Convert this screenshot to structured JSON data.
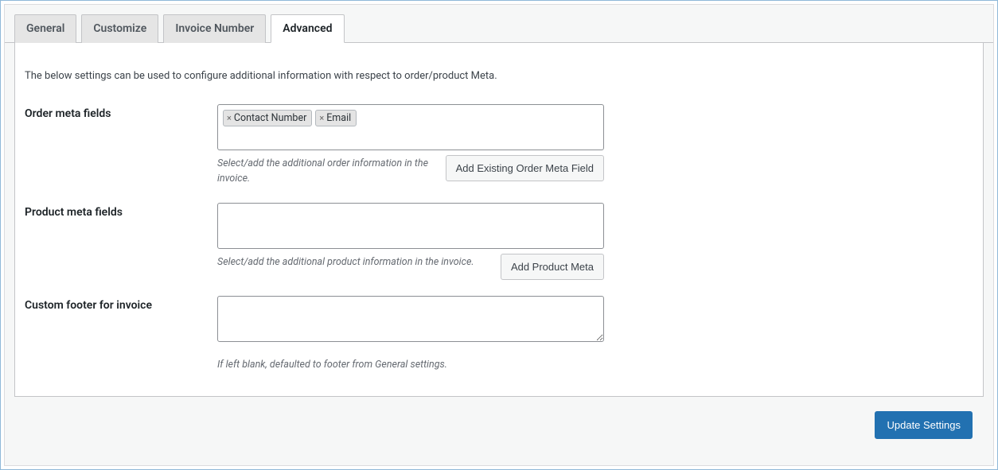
{
  "tabs": {
    "general": "General",
    "customize": "Customize",
    "invoice_number": "Invoice Number",
    "advanced": "Advanced"
  },
  "intro": "The below settings can be used to configure additional information with respect to order/product Meta.",
  "order_meta": {
    "label": "Order meta fields",
    "tags": [
      "Contact Number",
      "Email"
    ],
    "helper": "Select/add the additional order information in the invoice.",
    "button": "Add Existing Order Meta Field"
  },
  "product_meta": {
    "label": "Product meta fields",
    "helper": "Select/add the additional product information in the invoice.",
    "button": "Add Product Meta"
  },
  "custom_footer": {
    "label": "Custom footer for invoice",
    "value": "",
    "helper": "If left blank, defaulted to footer from General settings."
  },
  "submit_label": "Update Settings"
}
